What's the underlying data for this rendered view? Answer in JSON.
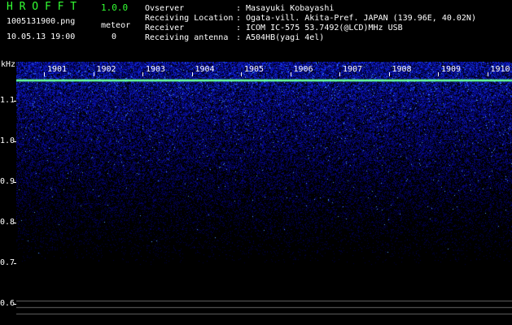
{
  "header": {
    "app_title": "H R O F F T",
    "app_version": "1.0.0",
    "filename": "1005131900.png",
    "datetime": "10.05.13 19:00",
    "meteor_label": "meteor",
    "meteor_count": "0",
    "info": [
      {
        "label": "Ovserver",
        "value": "Masayuki Kobayashi"
      },
      {
        "label": "Receiving Location",
        "value": "Ogata-vill. Akita-Pref. JAPAN (139.96E, 40.02N)"
      },
      {
        "label": "Receiver",
        "value": "ICOM IC-575 53.7492(@LCD)MHz USB"
      },
      {
        "label": "Receiving antenna",
        "value": "A504HB(yagi 4el)"
      }
    ]
  },
  "axis": {
    "unit": "kHz",
    "y_ticks": [
      "1.1",
      "1.0",
      "0.9",
      "0.8",
      "0.7",
      "0.6"
    ],
    "x_ticks": [
      "1901",
      "1902",
      "1903",
      "1904",
      "1905",
      "1906",
      "1907",
      "1908",
      "1909",
      "1910"
    ]
  },
  "colors": {
    "title": "#33ff33",
    "carrier": "#66ff99",
    "noise_hi": "#3355ff",
    "noise_lo": "#000044"
  }
}
